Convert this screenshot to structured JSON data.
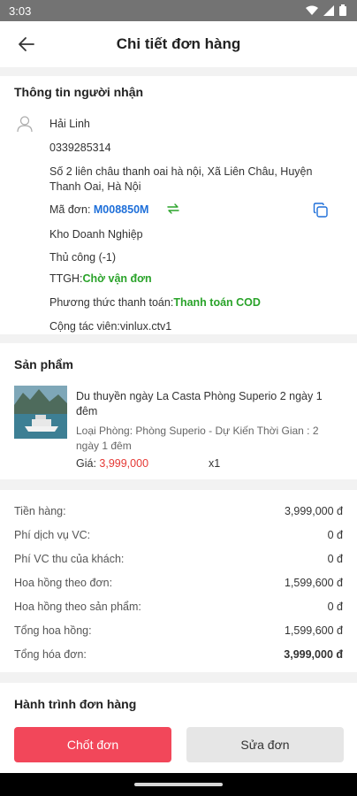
{
  "status_bar": {
    "time": "3:03",
    "icons": [
      "wifi-icon",
      "signal-icon",
      "battery-icon"
    ]
  },
  "header": {
    "title": "Chi tiết đơn hàng"
  },
  "recipient": {
    "section_title": "Thông tin người nhận",
    "name": "Hải Linh",
    "phone": "0339285314",
    "address_line1": "Số 2 liên châu thanh oai hà nội, Xã Liên Châu, Huyện",
    "address_line2": "Thanh Oai, Hà Nội",
    "order_code_label": "Mã đơn: ",
    "order_code": "M008850M",
    "warehouse": "Kho Doanh Nghiệp",
    "method": "Thủ công (-1)",
    "ttgh_label": "TTGH:",
    "ttgh_value": "Chờ vận đơn",
    "payment_label": "Phương thức thanh toán:",
    "payment_value": "Thanh toán COD",
    "collaborator": "Cộng tác viên:vinlux.ctv1"
  },
  "product": {
    "section_title": "Sản phẩm",
    "name_line1": "Du thuyền ngày La Casta Phòng Superio 2 ngày 1",
    "name_line2": "đêm",
    "detail_line1": "Loại Phòng: Phòng Superio - Dự Kiến Thời Gian : 2",
    "detail_line2": "ngày 1 đêm",
    "price_label": "Giá: ",
    "price": "3,999,000",
    "quantity": "x1"
  },
  "summary": [
    {
      "label": "Tiền hàng:",
      "value": "3,999,000 đ"
    },
    {
      "label": "Phí dịch vụ VC:",
      "value": "0 đ"
    },
    {
      "label": "Phí VC thu của khách:",
      "value": "0 đ"
    },
    {
      "label": "Hoa hồng theo đơn:",
      "value": "1,599,600 đ"
    },
    {
      "label": "Hoa hồng theo sản phẩm:",
      "value": "0 đ"
    },
    {
      "label": "Tổng hoa hồng:",
      "value": "1,599,600 đ"
    },
    {
      "label": "Tổng hóa đơn:",
      "value": "3,999,000 đ"
    }
  ],
  "journey": {
    "section_title": "Hành trình đơn hàng"
  },
  "actions": {
    "confirm_label": "Chốt đơn",
    "edit_label": "Sửa đơn"
  },
  "colors": {
    "accent": "#f2475a",
    "link": "#1e6fd9",
    "success": "#2aa32a",
    "danger": "#e53935"
  }
}
